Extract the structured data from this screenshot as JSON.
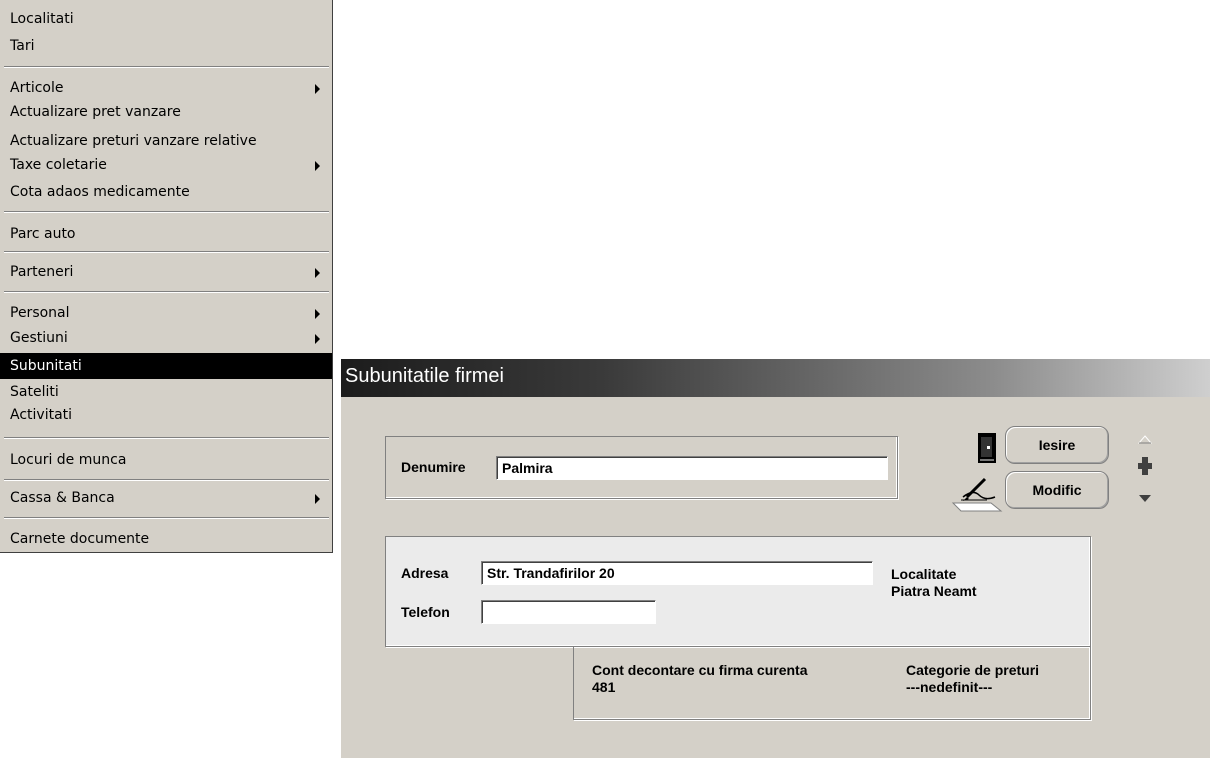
{
  "menu": {
    "items": [
      {
        "label": "Localitati"
      },
      {
        "label": "Tari"
      },
      {
        "label": "Articole"
      },
      {
        "label": "Actualizare pret vanzare"
      },
      {
        "label": "Actualizare preturi vanzare relative"
      },
      {
        "label": "Taxe coletarie"
      },
      {
        "label": "Cota adaos medicamente"
      },
      {
        "label": "Parc auto"
      },
      {
        "label": "Parteneri"
      },
      {
        "label": "Personal"
      },
      {
        "label": "Gestiuni"
      },
      {
        "label": "Subunitati"
      },
      {
        "label": "Sateliti"
      },
      {
        "label": "Activitati"
      },
      {
        "label": "Locuri de munca"
      },
      {
        "label": "Cassa & Banca"
      },
      {
        "label": "Carnete documente"
      }
    ],
    "selected": "Subunitati"
  },
  "dialog": {
    "title": "Subunitatile firmei",
    "denumire_label": "Denumire",
    "denumire_value": "Palmira",
    "buttons": {
      "iesire": "Iesire",
      "modific": "Modific"
    },
    "adresa_label": "Adresa",
    "adresa_value": "Str. Trandafirilor 20",
    "telefon_label": "Telefon",
    "telefon_value": "",
    "localitate_label": "Localitate",
    "localitate_value": "Piatra Neamt",
    "cont_label": "Cont decontare cu firma curenta",
    "cont_value": "481",
    "categorie_label": "Categorie de preturi",
    "categorie_value": "---nedefinit---"
  },
  "icons": [
    "door-exit-icon",
    "edit-pen-icon",
    "nav-up-icon",
    "nav-add-icon",
    "nav-down-icon",
    "submenu-arrow-icon"
  ]
}
